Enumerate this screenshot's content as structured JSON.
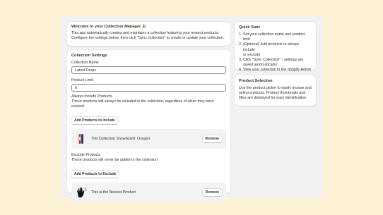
{
  "welcome": {
    "title": "Welcome to your Collection Manager 🎉",
    "line1": "This app automatically creates and maintains a collection featuring your newest products.",
    "line2": "Configure the settings below, then click \"Sync Collection\" to create or update your collection."
  },
  "settings": {
    "title": "Collection Settings",
    "name_label": "Collection Name",
    "name_value": "Latest Drops",
    "limit_label": "Product Limit",
    "limit_value": "6",
    "include_heading": "Always Include Products",
    "include_help": "These products will always be included in the collection, regardless of when they were created.",
    "include_button": "Add Products to Include",
    "include_product": "The Collection Snowboard: Oxygen",
    "include_remove": "Remove",
    "exclude_heading": "Exclude Products",
    "exclude_help": "These products will never be added to the collection.",
    "exclude_button": "Add Products to Exclude",
    "exclude_product": "This is the Newest Product",
    "exclude_remove": "Remove"
  },
  "quick_start": {
    "title": "Quick Start",
    "steps": [
      {
        "num": "1.",
        "lines": [
          "Set your collection name and product limit"
        ]
      },
      {
        "num": "2.",
        "lines": [
          "(Optional) Add products to always include",
          "or exclude"
        ]
      },
      {
        "num": "3.",
        "lines": [
          "Click \"Sync Collection\" - settings are",
          "saved automatically!"
        ]
      },
      {
        "num": "4.",
        "lines": [
          "View your collection in the Shopify Admin"
        ]
      }
    ]
  },
  "product_selection": {
    "title": "Product Selection",
    "lines": [
      "Use the product picker to easily browse and",
      "select products. Product thumbnails and",
      "titles are displayed for easy identification."
    ]
  },
  "colors": {
    "page_bg": "#fdf1d6",
    "frame_bg": "#f1f1f1",
    "row_bg": "#f3f3f3"
  }
}
